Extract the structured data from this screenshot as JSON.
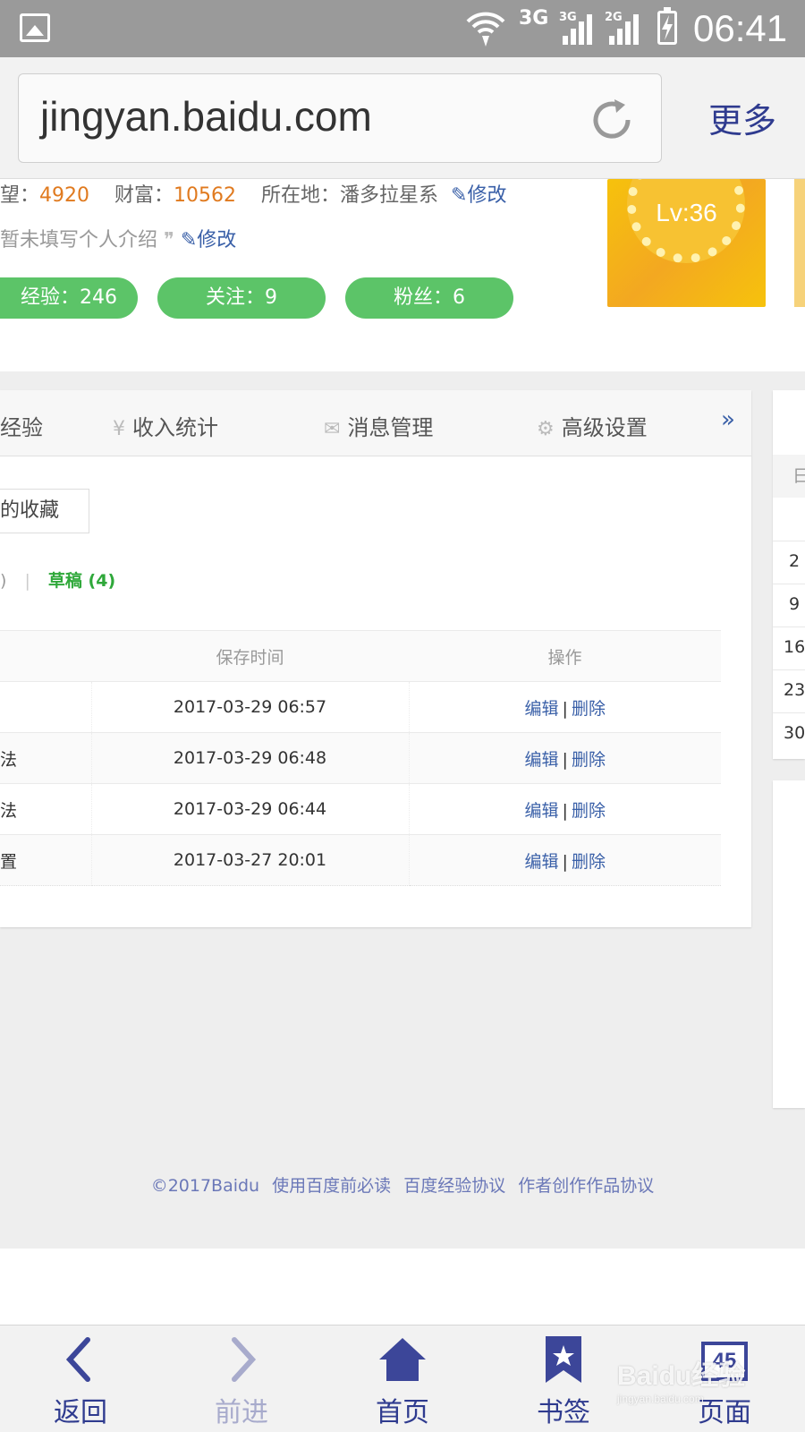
{
  "status_bar": {
    "net1": "3G",
    "net2": "3G",
    "net3": "2G",
    "time": "06:41"
  },
  "browser": {
    "url": "jingyan.baidu.com",
    "more_label": "更多"
  },
  "profile": {
    "prestige_label": "望：",
    "prestige_value": "4920",
    "wealth_label": "财富：",
    "wealth_value": "10562",
    "location_label": "所在地：",
    "location_value": "潘多拉星系",
    "edit_label": "修改",
    "intro_text": "暂未填写个人介绍",
    "pills": [
      "经验：246",
      "关注：9",
      "粉丝：6"
    ],
    "level": "Lv:36"
  },
  "tabs": [
    {
      "label": "经验",
      "icon": "experience-icon"
    },
    {
      "label": "收入统计",
      "icon": "yen-icon"
    },
    {
      "label": "消息管理",
      "icon": "mail-icon"
    },
    {
      "label": "高级设置",
      "icon": "gear-icon"
    }
  ],
  "tab_more": "»",
  "favorites_label": "的收藏",
  "filter": {
    "prev_paren": ")",
    "separator": "|",
    "draft_label": "草稿 (4)"
  },
  "table": {
    "headers": [
      "",
      "保存时间",
      "操作"
    ],
    "rows": [
      {
        "title": "",
        "time": "2017-03-29 06:57"
      },
      {
        "title": "法",
        "time": "2017-03-29 06:48"
      },
      {
        "title": "法",
        "time": "2017-03-29 06:44"
      },
      {
        "title": "置",
        "time": "2017-03-27 20:01"
      }
    ],
    "edit": "编辑",
    "sep": "|",
    "delete": "删除"
  },
  "calendar": {
    "header": "日",
    "dates": [
      "2",
      "9",
      "16",
      "23",
      "30"
    ]
  },
  "footer": {
    "copyright": "©2017Baidu",
    "links": [
      "使用百度前必读",
      "百度经验协议",
      "作者创作作品协议"
    ]
  },
  "bottom_nav": {
    "back": "返回",
    "forward": "前进",
    "home": "首页",
    "bookmarks": "书签",
    "pages": "页面",
    "page_count": "45"
  },
  "watermark": {
    "brand": "Baidu经验",
    "site": "jingyan.baidu.com"
  }
}
